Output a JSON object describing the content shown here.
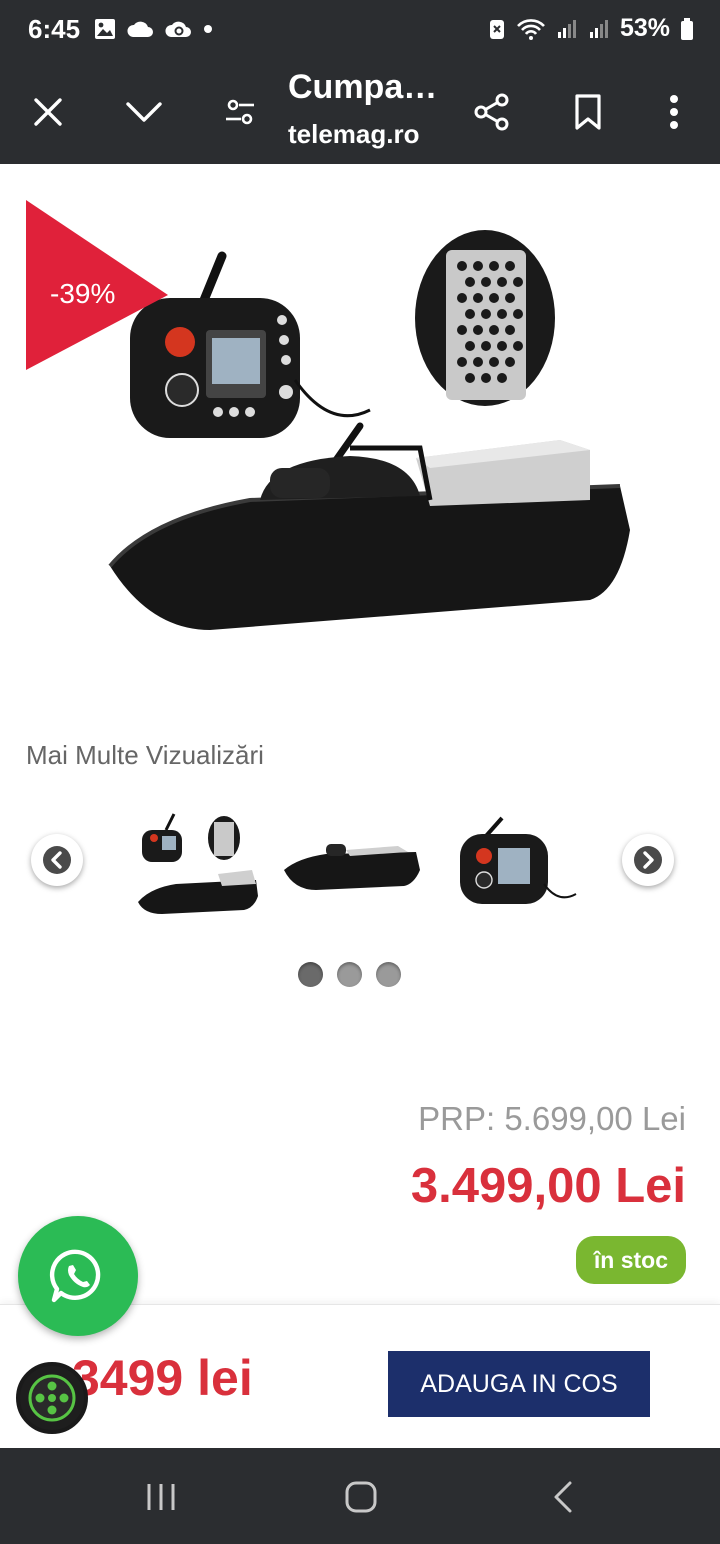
{
  "status_bar": {
    "time": "6:45",
    "battery": "53%"
  },
  "toolbar": {
    "title": "Cumpa…",
    "domain": "telemag.ro"
  },
  "product": {
    "discount": "-39%",
    "more_views_label": "Mai Multe Vizualizări",
    "prp": "PRP: 5.699,00 Lei",
    "price": "3.499,00 Lei",
    "stock": "în stoc",
    "carousel_pages": 3,
    "carousel_active_page": 1
  },
  "sticky": {
    "price": "3499 lei",
    "add_to_cart": "ADAUGA IN COS"
  },
  "colors": {
    "bar_background": "#2b2d30",
    "badge_red": "#e0213a",
    "price_red": "#d9303c",
    "stock_green": "#7ab730",
    "cart_button": "#1c2f6b",
    "whatsapp_green": "#2bbb55"
  }
}
